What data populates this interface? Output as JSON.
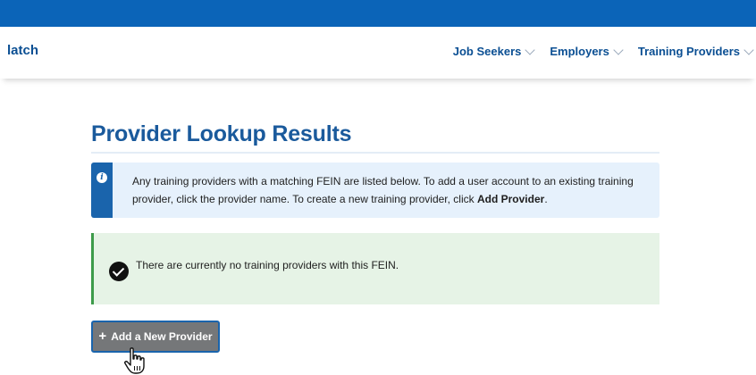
{
  "header": {
    "brand": "latch",
    "nav": [
      {
        "label": "Job Seekers"
      },
      {
        "label": "Employers"
      },
      {
        "label": "Training Providers"
      }
    ]
  },
  "main": {
    "title": "Provider Lookup Results",
    "info": {
      "text_before": "Any training providers with a matching FEIN are listed below. To add a user account to an existing training provider, click the provider name. To create a new training provider, click ",
      "text_bold": "Add Provider",
      "text_after": "."
    },
    "success": {
      "text": "There are currently no training providers with this FEIN."
    },
    "add_button": {
      "icon": "+",
      "label": "Add a New Provider"
    }
  },
  "colors": {
    "topbar": "#0b64b8",
    "link": "#0b4f93",
    "info_bg": "#e6f1fc",
    "success_bg": "#e6f3e6",
    "success_border": "#3d9b4a",
    "button_bg": "#757779"
  }
}
